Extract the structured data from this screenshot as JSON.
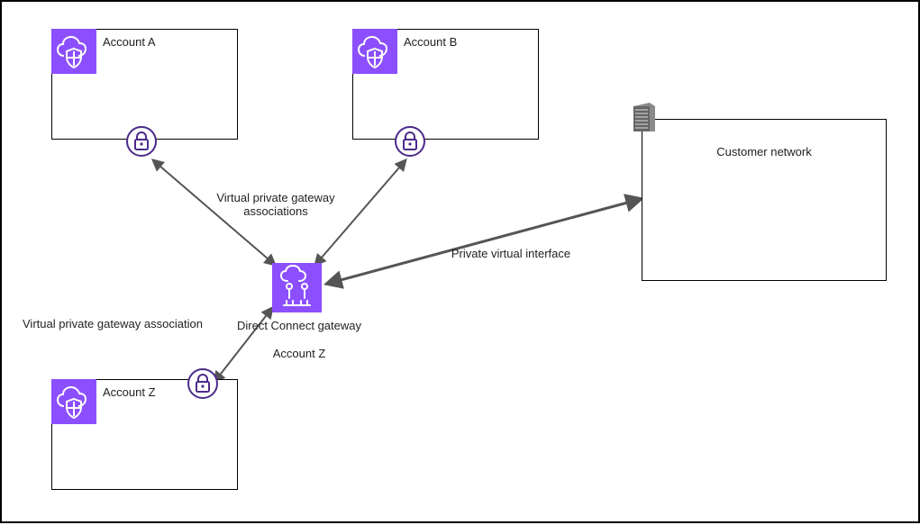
{
  "diagram": {
    "accountA": {
      "label": "Account A"
    },
    "accountB": {
      "label": "Account B"
    },
    "accountZ": {
      "label": "Account Z"
    },
    "customerNetwork": {
      "label": "Customer network"
    },
    "dcGateway": {
      "label": "Direct Connect gateway",
      "account": "Account Z"
    },
    "edge": {
      "vpgAssoc": "Virtual private gateway association",
      "vpgAssocPlural": "Virtual private gateway\nassociations",
      "pvi": "Private virtual interface"
    }
  }
}
